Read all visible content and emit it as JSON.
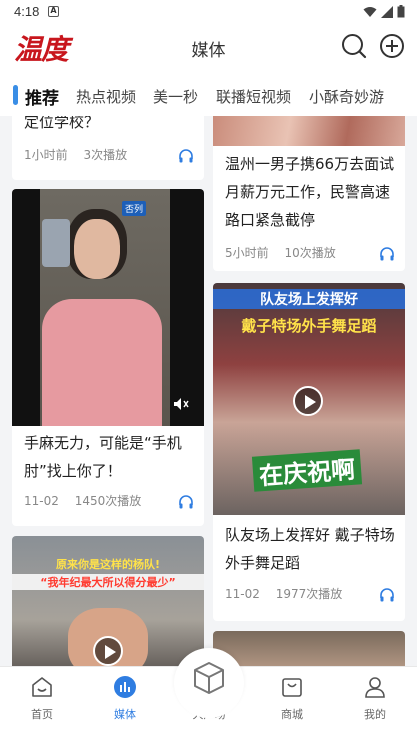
{
  "status": {
    "time": "4:18",
    "notif_glyph": "A"
  },
  "header": {
    "logo": "温度",
    "title": "媒体",
    "search_icon": "search-icon",
    "add_icon": "plus-circle-icon"
  },
  "tabs": [
    {
      "label": "推荐",
      "active": true
    },
    {
      "label": "热点视频"
    },
    {
      "label": "美一秒"
    },
    {
      "label": "联播短视频"
    },
    {
      "label": "小酥奇妙游"
    }
  ],
  "cards": {
    "c1": {
      "title": "定位学校？",
      "time": "1小时前",
      "plays": "3次播放"
    },
    "c2": {
      "title": "温州一男子携66万去面试月薪万元工作，民警高速路口紧急截停",
      "time": "5小时前",
      "plays": "10次播放"
    },
    "c3": {
      "title": "手麻无力，可能是“手机肘”找上你了！",
      "time": "11-02",
      "plays": "1450次播放",
      "overlay_tag": "否列"
    },
    "c4": {
      "title": "队友场上发挥好 戴子特场外手舞足蹈",
      "time": "11-02",
      "plays": "1977次播放",
      "overlay_top": "队友场上发挥好",
      "overlay_main": "戴子特场外手舞足蹈",
      "overlay_cheer": "在庆祝啊"
    },
    "c5": {
      "overlay_top": "原来你是这样的杨队!",
      "overlay_quote": "“我年纪最大所以得分最少”"
    }
  },
  "bottomnav": [
    {
      "label": "首页",
      "icon": "home-icon"
    },
    {
      "label": "媒体",
      "icon": "media-icon",
      "active": true
    },
    {
      "label": "大广场",
      "icon": "cube-icon"
    },
    {
      "label": "商城",
      "icon": "shop-icon"
    },
    {
      "label": "我的",
      "icon": "user-icon"
    }
  ],
  "colors": {
    "accent": "#2f7de1",
    "brand": "#c8161d"
  }
}
